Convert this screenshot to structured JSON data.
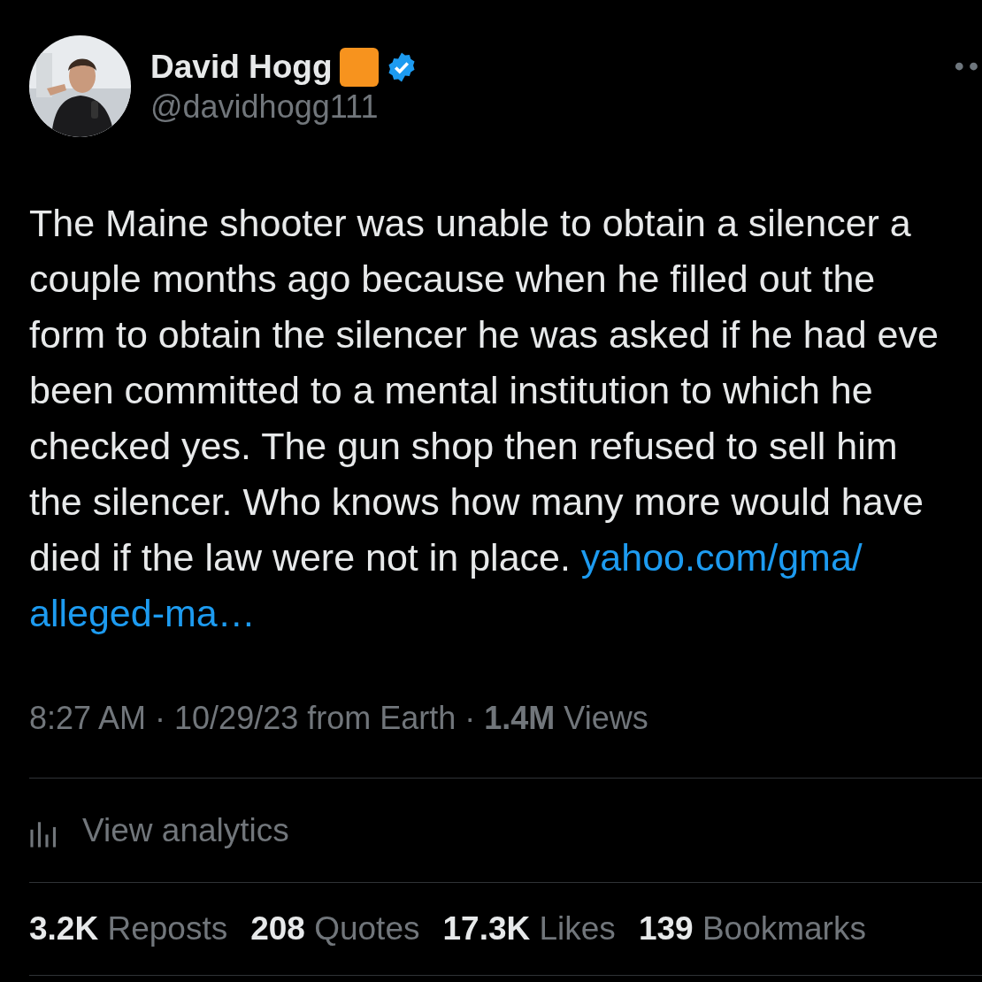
{
  "author": {
    "name": "David Hogg",
    "handle": "@davidhogg111",
    "verified": true
  },
  "tweet": {
    "text": "The Maine shooter was unable to obtain a silencer a\ncouple months ago because when he filled out the\nform to obtain the silencer he was asked if he had eve\nbeen committed to a mental institution to which he\nchecked yes. The gun shop then refused to sell him\nthe silencer. Who knows how many more would have\ndied if the law were not in place. ",
    "link_lines": [
      "yahoo.com/gma/",
      "alleged-ma…"
    ]
  },
  "meta": "8:27 AM · 10/29/23 from Earth · **1.4M** Views",
  "analytics": {
    "label": "View analytics"
  },
  "stats": [
    {
      "count": "3.2K",
      "label": "Reposts"
    },
    {
      "count": "208",
      "label": "Quotes"
    },
    {
      "count": "17.3K",
      "label": "Likes"
    },
    {
      "count": "139",
      "label": "Bookmarks"
    }
  ]
}
